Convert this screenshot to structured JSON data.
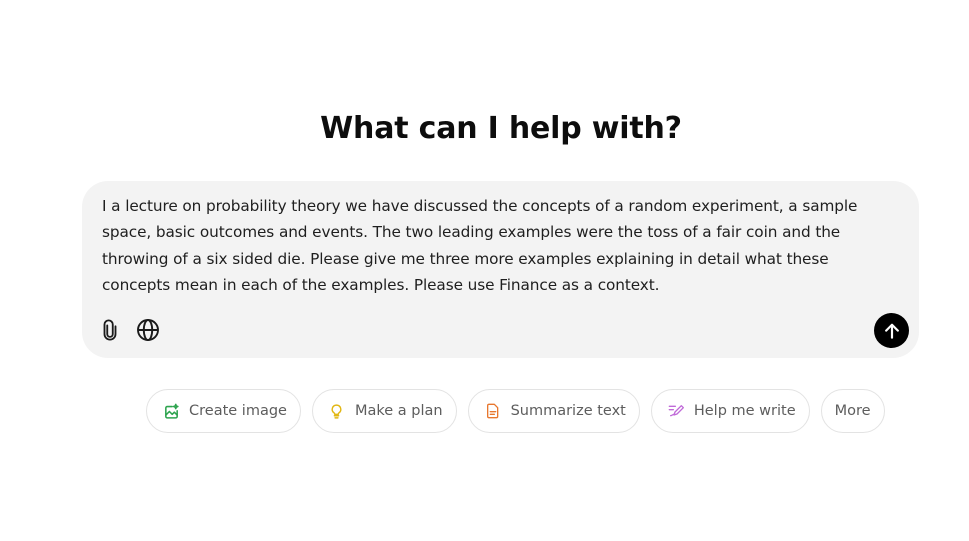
{
  "heading": "What can I help with?",
  "composer": {
    "text": "I a lecture on probability theory we have discussed the concepts of a random experiment, a sample space, basic outcomes and events. The two leading examples were the toss of a fair coin and the throwing of a six sided die. Please give me three more examples explaining in detail what these concepts mean in each of the examples. Please use Finance as a context.",
    "attach_icon": "paperclip-icon",
    "globe_icon": "globe-icon",
    "send_icon": "arrow-up-icon"
  },
  "chips": [
    {
      "label": "Create image",
      "icon": "image-icon",
      "color": "#2ea44f"
    },
    {
      "label": "Make a plan",
      "icon": "lightbulb-icon",
      "color": "#e2b714"
    },
    {
      "label": "Summarize text",
      "icon": "document-icon",
      "color": "#e8772e"
    },
    {
      "label": "Help me write",
      "icon": "pen-icon",
      "color": "#c06ad8"
    },
    {
      "label": "More",
      "icon": "",
      "color": ""
    }
  ],
  "colors": {
    "composer_bg": "#f3f3f3",
    "send_bg": "#000000",
    "chip_border": "#e3e3e3",
    "chip_text": "#5d5d5d"
  }
}
